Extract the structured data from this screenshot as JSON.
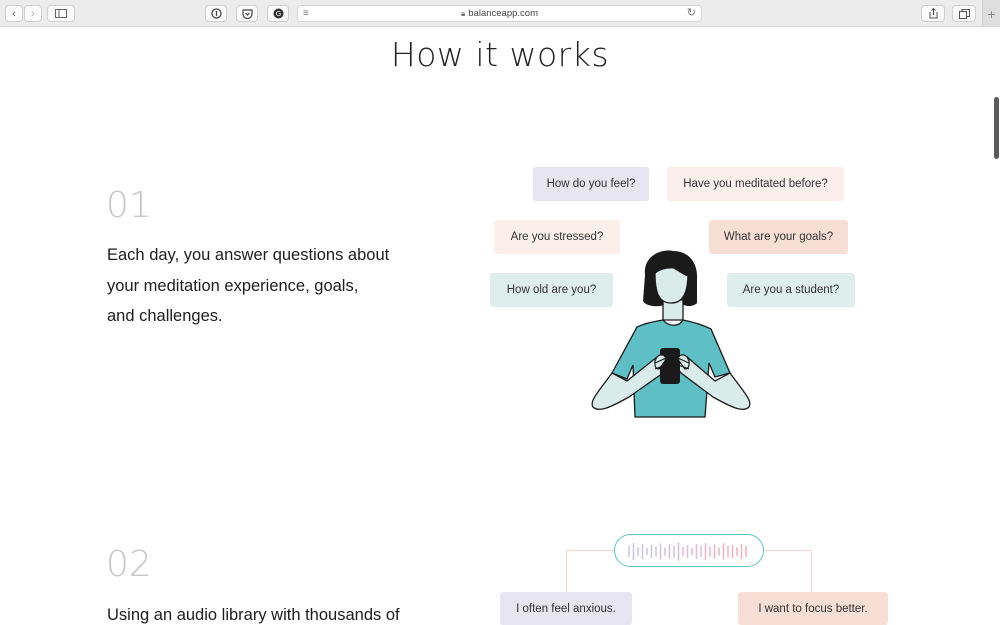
{
  "browser": {
    "url": "balanceapp.com",
    "icons": [
      "back-icon",
      "forward-icon",
      "sidebar-icon",
      "password-icon",
      "pocket-icon",
      "grammarly-icon",
      "reader-icon",
      "lock-icon",
      "reload-icon",
      "share-icon",
      "tabs-icon",
      "new-tab-icon"
    ]
  },
  "page": {
    "title": "How it works"
  },
  "steps": [
    {
      "number": "01",
      "text_lines": [
        "Each day, you answer questions about",
        "your meditation experience, goals,",
        "and challenges."
      ]
    },
    {
      "number": "02",
      "text_lines": [
        "Using an audio library with thousands of"
      ]
    }
  ],
  "questions": [
    {
      "text": "How do you feel?",
      "color": "#e7e5f1"
    },
    {
      "text": "Have you meditated before?",
      "color": "#fcefeb"
    },
    {
      "text": "Are you stressed?",
      "color": "#fbf0e9"
    },
    {
      "text": "What are your goals?",
      "color": "#f8dfd6"
    },
    {
      "text": "How old are you?",
      "color": "#ddeeed"
    },
    {
      "text": "Are you a student?",
      "color": "#ddeeed"
    }
  ],
  "answers": [
    {
      "text": "I often feel anxious.",
      "color": "#e7e5f1"
    },
    {
      "text": "I want to focus better.",
      "color": "#f8dfd6"
    }
  ],
  "colors": {
    "accent_teal": "#5ec3c4",
    "shirt": "#5ebfc4",
    "skin": "#d9ecea"
  }
}
